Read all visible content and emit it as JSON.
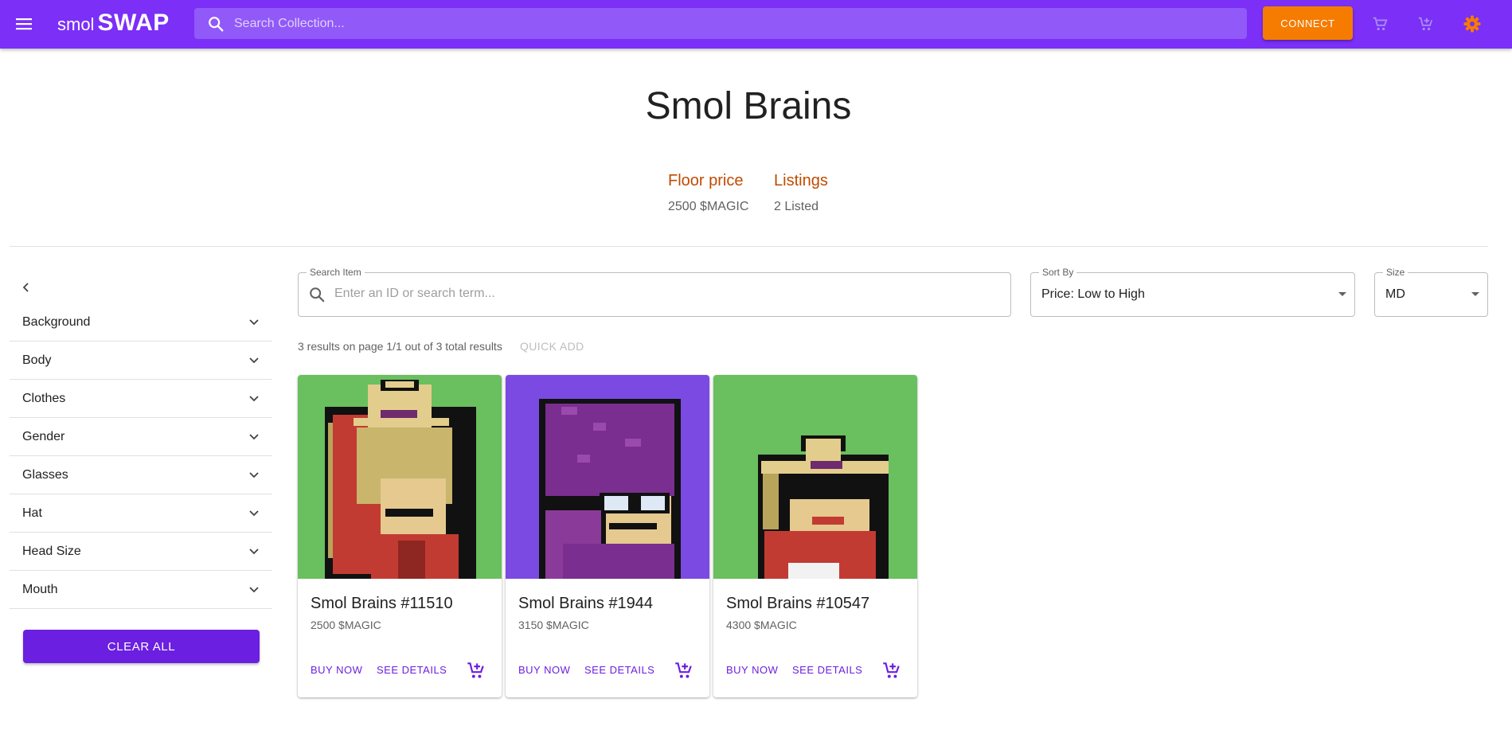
{
  "app": {
    "logo_small": "smol",
    "logo_big": "SWAP",
    "search_placeholder": "Search Collection...",
    "connect_label": "CONNECT",
    "accent": "#7b2ff7",
    "connect_color": "#f57c00"
  },
  "collection": {
    "title": "Smol Brains",
    "floor_label": "Floor price",
    "floor_value": "2500 $MAGIC",
    "listings_label": "Listings",
    "listings_value": "2 Listed"
  },
  "sidebar": {
    "filters": [
      {
        "label": "Background"
      },
      {
        "label": "Body"
      },
      {
        "label": "Clothes"
      },
      {
        "label": "Gender"
      },
      {
        "label": "Glasses"
      },
      {
        "label": "Hat"
      },
      {
        "label": "Head Size"
      },
      {
        "label": "Mouth"
      }
    ],
    "clear_label": "CLEAR ALL"
  },
  "controls": {
    "search_legend": "Search Item",
    "search_placeholder": "Enter an ID or search term...",
    "sort_legend": "Sort By",
    "sort_value": "Price: Low to High",
    "size_legend": "Size",
    "size_value": "MD"
  },
  "results": {
    "summary": "3 results on page 1/1 out of 3 total results",
    "quick_add": "QUICK ADD"
  },
  "cards": [
    {
      "name": "Smol Brains #11510",
      "price": "2500 $MAGIC",
      "buy": "BUY NOW",
      "details": "SEE DETAILS",
      "bg": "#6abf5e"
    },
    {
      "name": "Smol Brains #1944",
      "price": "3150 $MAGIC",
      "buy": "BUY NOW",
      "details": "SEE DETAILS",
      "bg": "#7b4ae2"
    },
    {
      "name": "Smol Brains #10547",
      "price": "4300 $MAGIC",
      "buy": "BUY NOW",
      "details": "SEE DETAILS",
      "bg": "#6abf5e"
    }
  ]
}
